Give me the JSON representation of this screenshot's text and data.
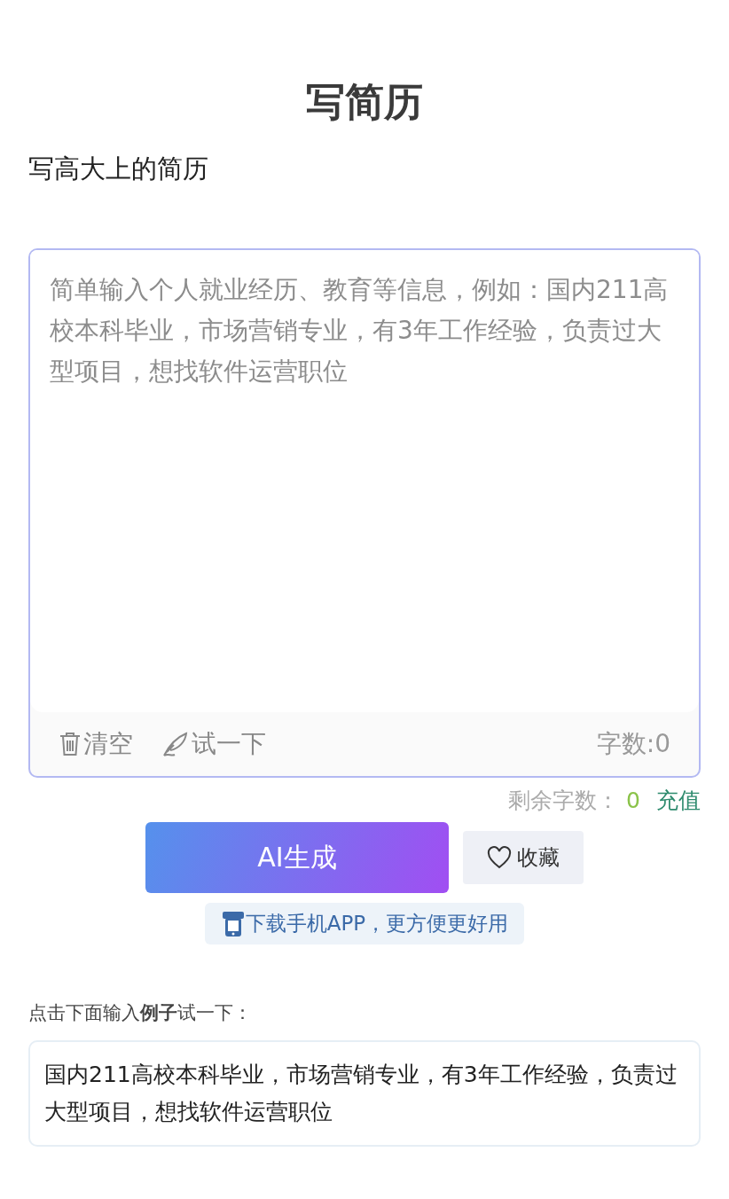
{
  "page": {
    "title": "写简历",
    "subtitle": "写高大上的简历"
  },
  "editor": {
    "placeholder": "简单输入个人就业经历、教育等信息，例如：国内211高校本科毕业，市场营销专业，有3年工作经验，负责过大型项目，想找软件运营职位",
    "clear_label": "清空",
    "try_label": "试一下",
    "count": "字数:0"
  },
  "quota": {
    "label": "剩余字数：",
    "value": "0",
    "recharge": "充值"
  },
  "buttons": {
    "generate": "AI生成",
    "favorite": "收藏",
    "app_download": "下载手机APP，更方便更好用"
  },
  "example": {
    "label": "点击下面输入**例子**试一下：",
    "text": "国内211高校本科毕业，市场营销专业，有3年工作经验，负责过大型项目，想找软件运营职位"
  }
}
